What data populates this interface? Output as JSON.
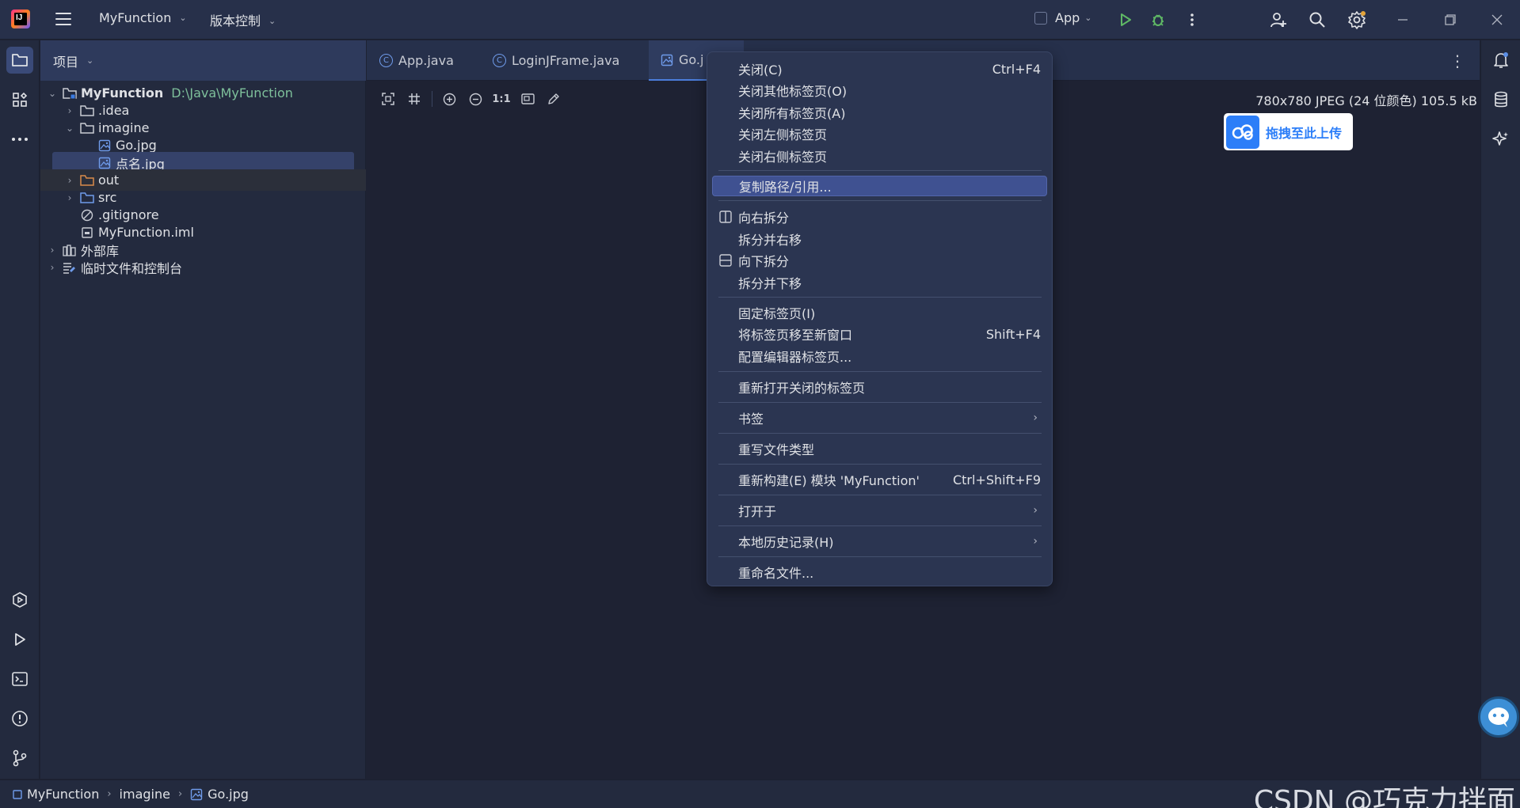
{
  "titlebar": {
    "project_menu": "MyFunction",
    "vcs_menu": "版本控制",
    "run_config": "App"
  },
  "project_panel": {
    "header": "项目",
    "tree": [
      {
        "label": "MyFunction",
        "hint": "D:\\Java\\MyFunction",
        "icon": "module-folder-icon",
        "expanded": true
      },
      {
        "label": ".idea",
        "icon": "folder-icon",
        "expanded": false
      },
      {
        "label": "imagine",
        "icon": "folder-icon",
        "expanded": true
      },
      {
        "label": "Go.jpg",
        "icon": "image-file-icon"
      },
      {
        "label": "点名.jpg",
        "icon": "image-file-icon",
        "selected": true
      },
      {
        "label": "out",
        "icon": "folder-orange-icon",
        "expanded": false
      },
      {
        "label": "src",
        "icon": "folder-blue-icon",
        "expanded": false
      },
      {
        "label": ".gitignore",
        "icon": "ignore-file-icon"
      },
      {
        "label": "MyFunction.iml",
        "icon": "iml-file-icon"
      },
      {
        "label": "外部库",
        "icon": "library-icon",
        "expanded": false
      },
      {
        "label": "临时文件和控制台",
        "icon": "scratches-icon",
        "expanded": false
      }
    ]
  },
  "editor": {
    "tabs": [
      {
        "label": "App.java",
        "icon": "class-icon"
      },
      {
        "label": "LoginJFrame.java",
        "icon": "class-icon"
      },
      {
        "label": "Go.jpg",
        "visible_label": "Go.j",
        "icon": "image-file-icon",
        "active": true
      }
    ],
    "image_toolbar": {
      "actual_size": "1:1"
    },
    "image_info": "780x780 JPEG (24 位颜色) 105.5 kB",
    "upload_button": "拖拽至此上传"
  },
  "context_menu": {
    "groups": [
      [
        {
          "label": "关闭(C)",
          "shortcut": "Ctrl+F4"
        },
        {
          "label": "关闭其他标签页(O)"
        },
        {
          "label": "关闭所有标签页(A)"
        },
        {
          "label": "关闭左侧标签页"
        },
        {
          "label": "关闭右侧标签页"
        }
      ],
      [
        {
          "label": "复制路径/引用...",
          "highlighted": true
        }
      ],
      [
        {
          "label": "向右拆分",
          "icon": "split-vertical-icon"
        },
        {
          "label": "拆分并右移"
        },
        {
          "label": "向下拆分",
          "icon": "split-horizontal-icon"
        },
        {
          "label": "拆分并下移"
        }
      ],
      [
        {
          "label": "固定标签页(I)"
        },
        {
          "label": "将标签页移至新窗口",
          "shortcut": "Shift+F4"
        },
        {
          "label": "配置编辑器标签页..."
        }
      ],
      [
        {
          "label": "重新打开关闭的标签页"
        }
      ],
      [
        {
          "label": "书签",
          "submenu": true
        }
      ],
      [
        {
          "label": "重写文件类型"
        }
      ],
      [
        {
          "label": "重新构建(E) 模块 'MyFunction'",
          "shortcut": "Ctrl+Shift+F9"
        }
      ],
      [
        {
          "label": "打开于",
          "submenu": true
        }
      ],
      [
        {
          "label": "本地历史记录(H)",
          "submenu": true
        }
      ],
      [
        {
          "label": "重命名文件..."
        }
      ]
    ]
  },
  "statusbar": {
    "breadcrumbs": [
      "MyFunction",
      "imagine",
      "Go.jpg"
    ]
  },
  "watermark": "CSDN @巧克力拌面",
  "colors": {
    "accent": "#4b7ddb",
    "background": "#1e2233",
    "panel": "#232a3e",
    "menu_highlight": "#3f5191",
    "path_hint": "#7ec09b",
    "upload_blue": "#2c7ef8"
  }
}
